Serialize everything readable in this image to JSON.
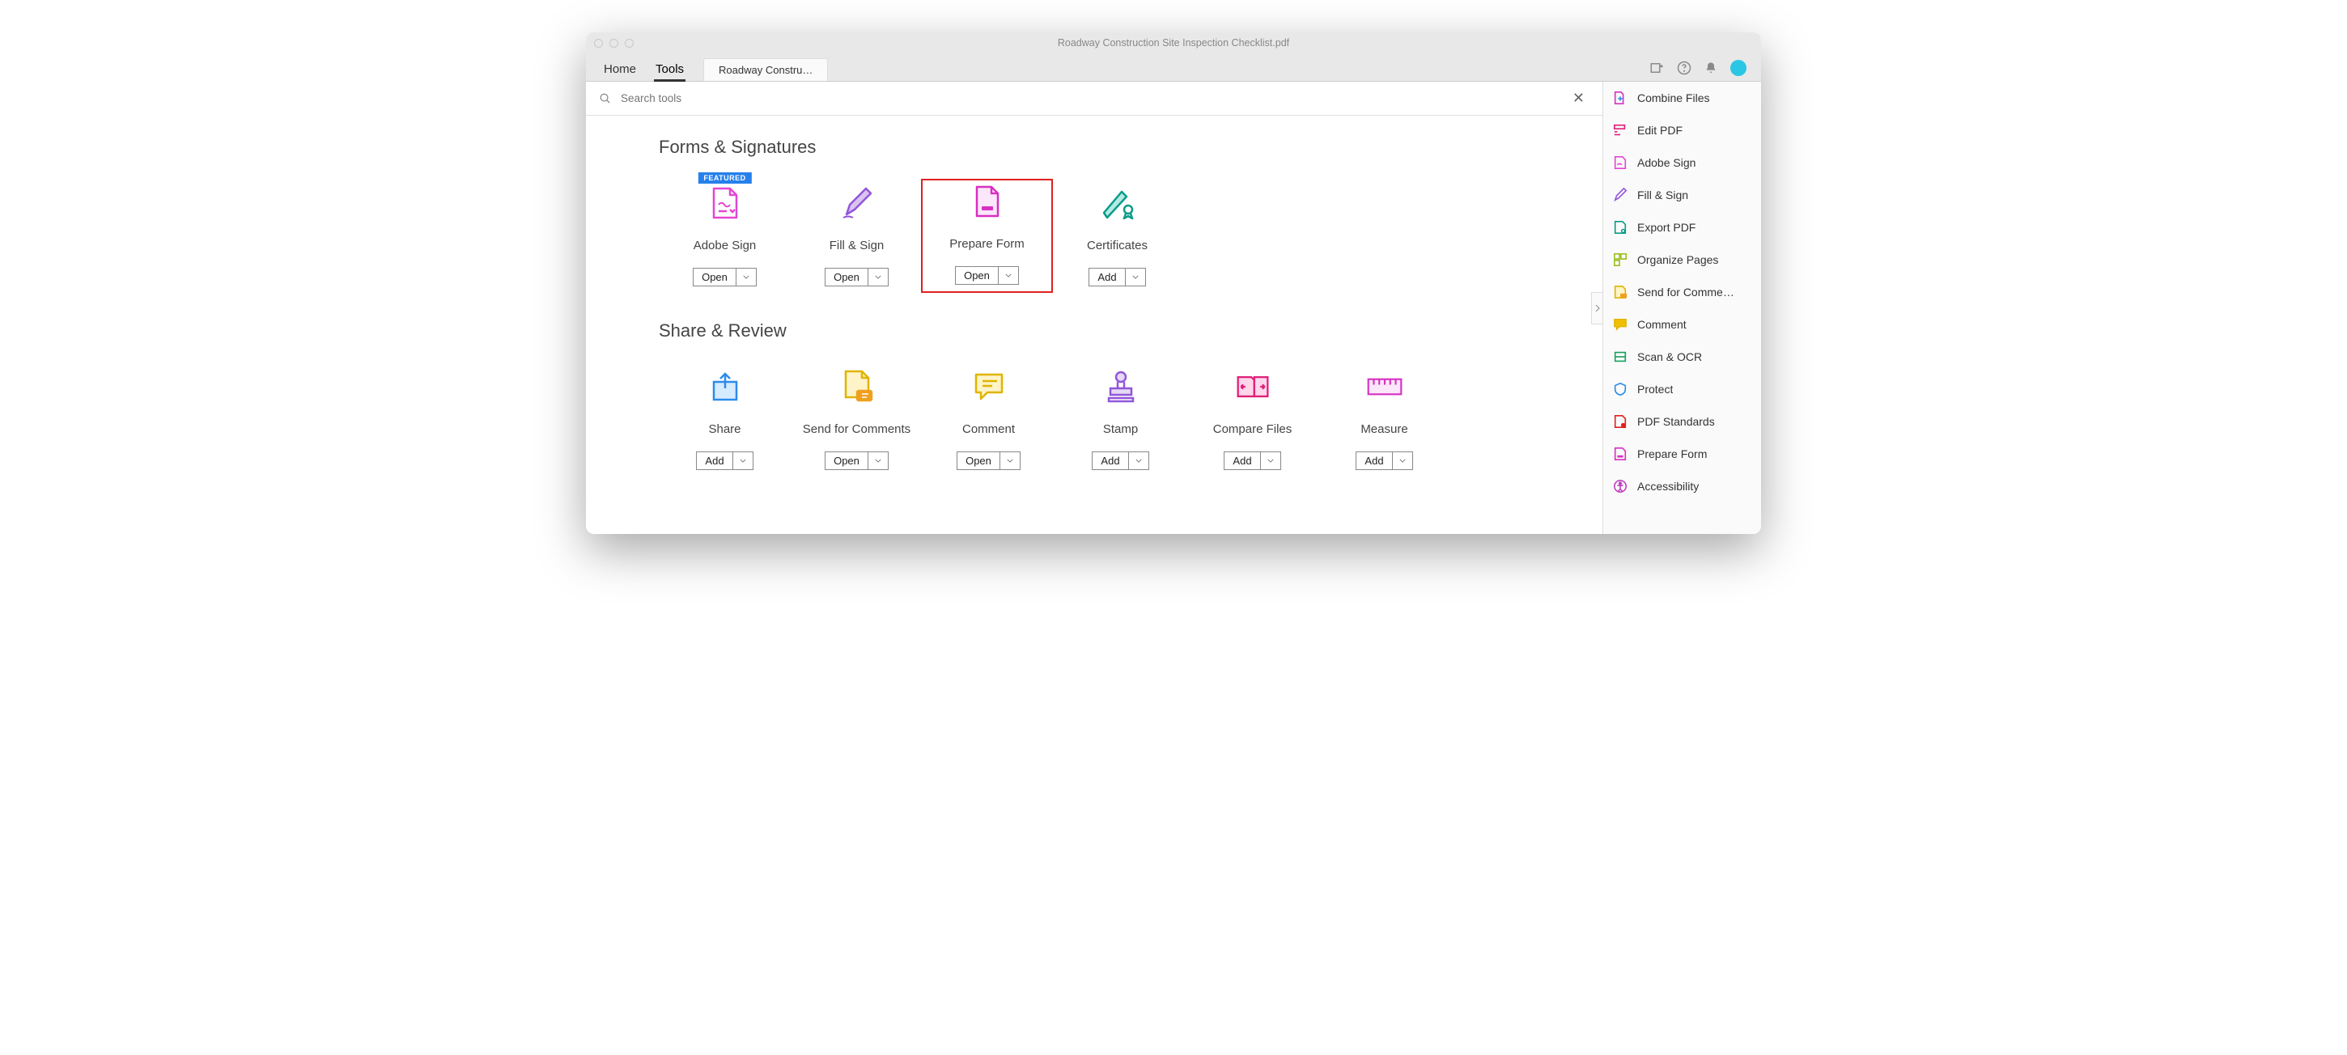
{
  "window": {
    "title": "Roadway Construction Site Inspection Checklist.pdf"
  },
  "nav": {
    "home": "Home",
    "tools": "Tools",
    "docTab": "Roadway Constru…"
  },
  "search": {
    "placeholder": "Search tools"
  },
  "sections": {
    "forms": {
      "title": "Forms & Signatures"
    },
    "share": {
      "title": "Share & Review"
    }
  },
  "badges": {
    "featured": "FEATURED"
  },
  "buttons": {
    "open": "Open",
    "add": "Add"
  },
  "tools": {
    "forms": {
      "adobeSign": {
        "label": "Adobe Sign",
        "action": "open"
      },
      "fillSign": {
        "label": "Fill & Sign",
        "action": "open"
      },
      "prepareForm": {
        "label": "Prepare Form",
        "action": "open"
      },
      "certificates": {
        "label": "Certificates",
        "action": "add"
      }
    },
    "share": {
      "share": {
        "label": "Share",
        "action": "add"
      },
      "sendComments": {
        "label": "Send for Comments",
        "action": "open"
      },
      "comment": {
        "label": "Comment",
        "action": "open"
      },
      "stamp": {
        "label": "Stamp",
        "action": "add"
      },
      "compare": {
        "label": "Compare Files",
        "action": "add"
      },
      "measure": {
        "label": "Measure",
        "action": "add"
      }
    }
  },
  "panel": {
    "combine": "Combine Files",
    "editPdf": "Edit PDF",
    "adobeSign": "Adobe Sign",
    "fillSign": "Fill & Sign",
    "exportPdf": "Export PDF",
    "organize": "Organize Pages",
    "sendComments": "Send for Comme…",
    "comment": "Comment",
    "scanOcr": "Scan & OCR",
    "protect": "Protect",
    "pdfStandards": "PDF Standards",
    "prepareForm": "Prepare Form",
    "accessibility": "Accessibility"
  }
}
